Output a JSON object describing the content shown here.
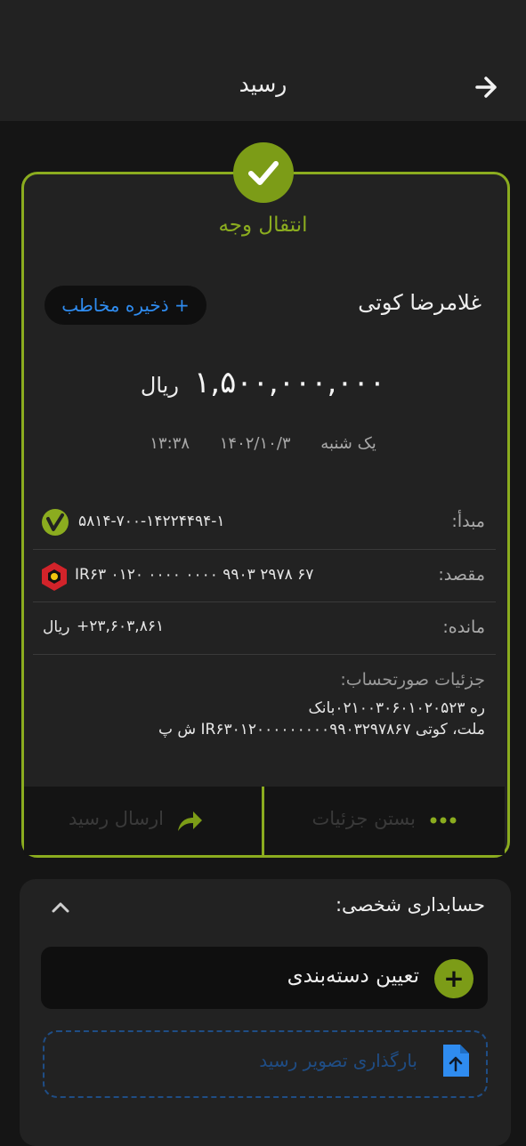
{
  "header": {
    "title": "رسید"
  },
  "receipt": {
    "title": "انتقال وجه",
    "contact_name": "غلامرضا کوتی",
    "save_contact": "+ ذخیره مخاطب",
    "amount": "۱,۵۰۰,۰۰۰,۰۰۰",
    "amount_unit": "ریال",
    "day": "یک شنبه",
    "date": "۱۴۰۲/۱۰/۳",
    "time": "۱۳:۳۸",
    "rows": [
      {
        "label": "مبدأ:",
        "value": "۵۸۱۴-۷۰۰-۱۴۲۲۴۴۹۴-۱"
      },
      {
        "label": "مقصد:",
        "value": "IR۶۳ ۰۱۲۰ ۰۰۰۰ ۰۰۰۰ ۹۹۰۳ ۲۹۷۸ ۶۷"
      },
      {
        "label": "مانده:",
        "value": "+۲۳,۶۰۳,۸۶۱",
        "unit": "ریال"
      }
    ],
    "details_label": "جزئیات صورتحساب:",
    "details_line1": "ره ۰۲۱۰۰۳۰۶۰۱۰۲۰۵۲۳بانک",
    "details_line2": "ملت، کوتی IR۶۳۰۱۲۰۰۰۰۰۰۰۰۰۹۹۰۳۲۹۷۸۶۷ ش پ",
    "actions": {
      "details": "بستن جزئیات",
      "send": "ارسال رسید"
    }
  },
  "accounting": {
    "title": "حسابداری شخصی:",
    "category_label": "تعیین دسته‌بندی",
    "category_plus": "+",
    "upload_label": "بارگذاری تصویر رسید"
  },
  "colors": {
    "accent": "#8bac1f",
    "link": "#2f8cf0",
    "bank_red": "#d2232a"
  }
}
